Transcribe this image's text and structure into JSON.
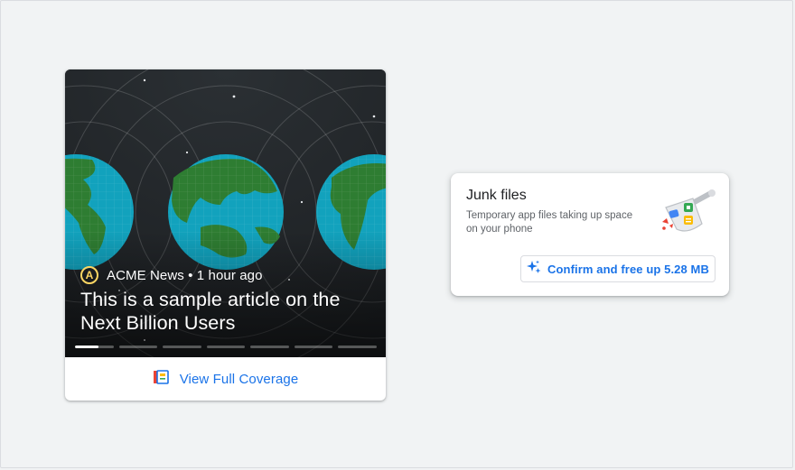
{
  "news_card": {
    "source_logo_letter": "A",
    "source_meta": "ACME News • 1 hour ago",
    "headline": "This is a sample article on the Next Billion Users",
    "story_progress": {
      "segments": 7,
      "active_index": 0,
      "active_fraction": 0.6
    },
    "coverage_label": "View Full Coverage",
    "coverage_icon": "full-coverage-icon",
    "image_subject": "planet-icon",
    "colors": {
      "accent": "#1a73e8",
      "ocean": "#12a2bd",
      "land": "#2e7d32",
      "logo": "#fdd663"
    }
  },
  "junk_card": {
    "title": "Junk files",
    "description": "Temporary app files taking up space on your phone",
    "illustration": "dustpan-icon",
    "button_label": "Confirm and free up 5.28 MB",
    "button_icon": "sparkle-icon"
  }
}
